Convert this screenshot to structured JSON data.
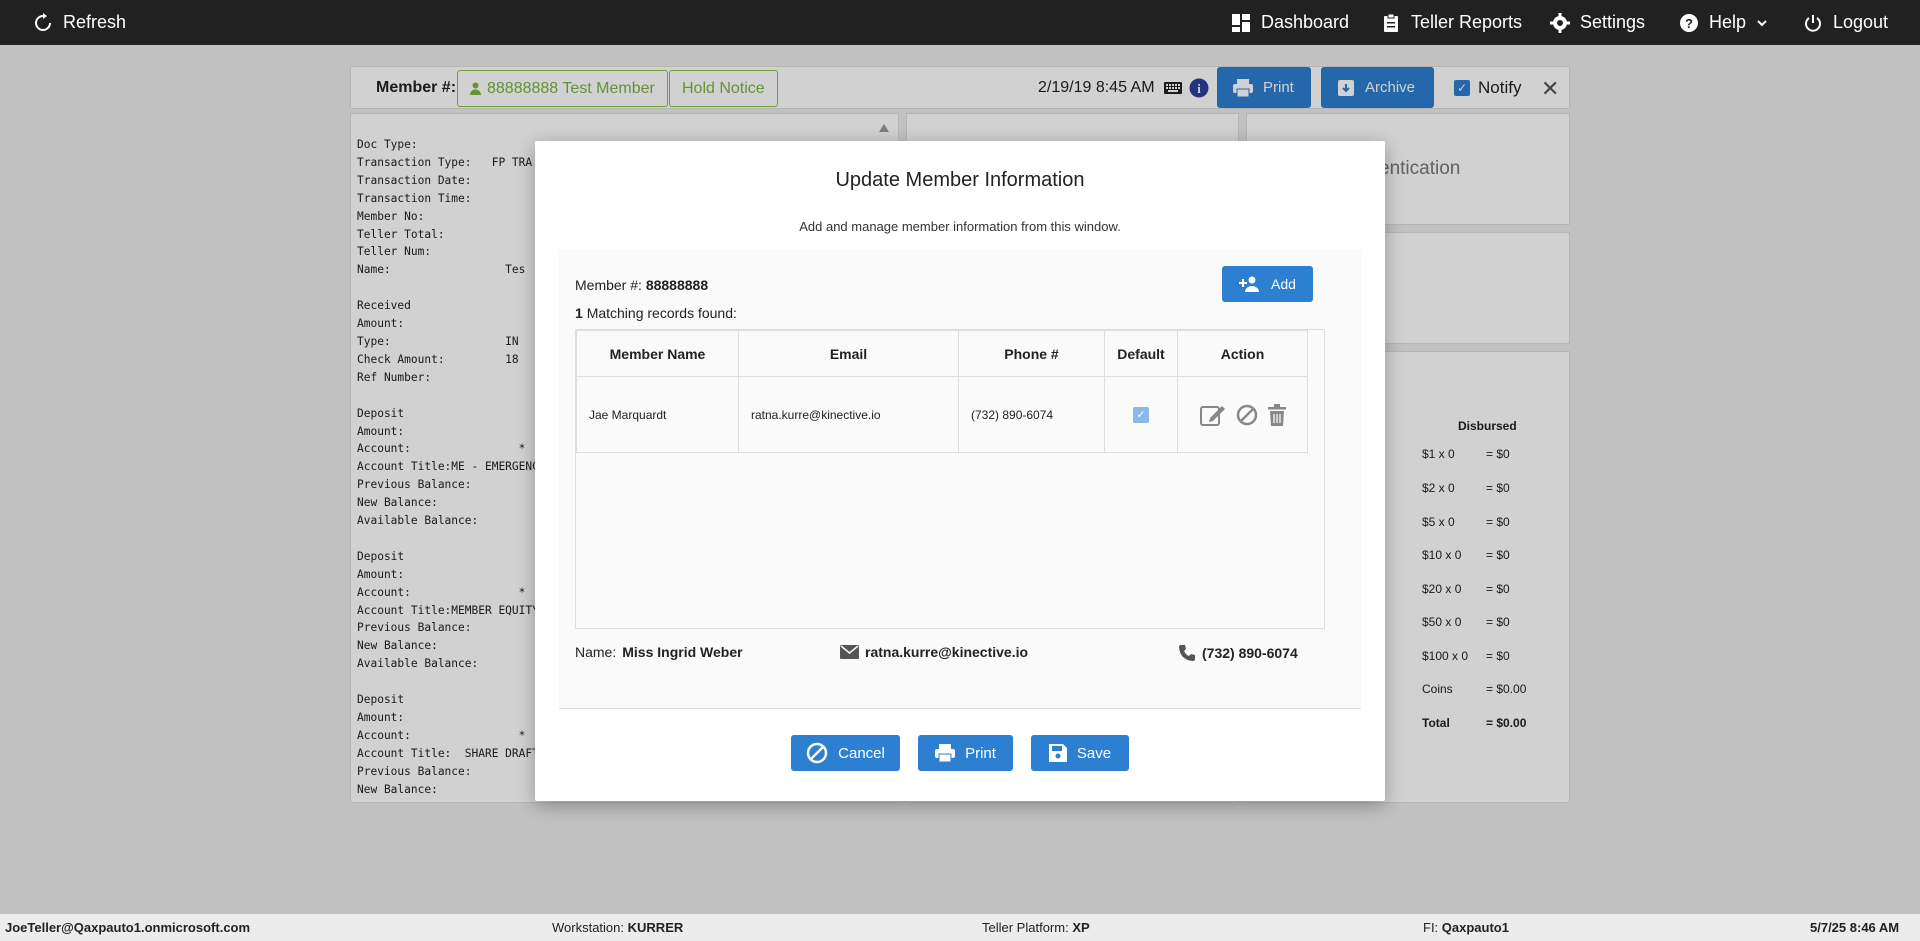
{
  "topnav": {
    "refresh": "Refresh",
    "dashboard": "Dashboard",
    "teller_reports": "Teller Reports",
    "settings": "Settings",
    "help": "Help",
    "logout": "Logout"
  },
  "memberbar": {
    "label": "Member #:",
    "member_button": "88888888 Test Member",
    "hold_notice": "Hold Notice",
    "datetime": "2/19/19 8:45 AM",
    "print": "Print",
    "archive": "Archive",
    "notify": "Notify"
  },
  "receipt": {
    "text": "Doc Type:\nTransaction Type:   FP TRA\nTransaction Date:\nTransaction Time:\nMember No:\nTeller Total:\nTeller Num:\nName:                 Tes\n\nReceived\nAmount:\nType:                 IN\nCheck Amount:         18\nRef Number:\n\nDeposit\nAmount:\nAccount:                *\nAccount Title:ME - EMERGENC\nPrevious Balance:\nNew Balance:\nAvailable Balance:\n\nDeposit\nAmount:\nAccount:                *\nAccount Title:MEMBER EQUITY\nPrevious Balance:\nNew Balance:\nAvailable Balance:\n\nDeposit\nAmount:\nAccount:                *\nAccount Title:  SHARE DRAFT\nPrevious Balance:\nNew Balance:"
  },
  "right_panel": {
    "auth_title": "entication",
    "disbursed_header": "Disbursed",
    "rows": [
      {
        "denom": "$1 x 0",
        "total": "= $0"
      },
      {
        "denom": "$2 x 0",
        "total": "= $0"
      },
      {
        "denom": "$5 x 0",
        "total": "= $0"
      },
      {
        "denom": "$10 x 0",
        "total": "= $0"
      },
      {
        "denom": "$20 x 0",
        "total": "= $0"
      },
      {
        "denom": "$50 x 0",
        "total": "= $0"
      },
      {
        "denom": "$100 x 0",
        "total": "= $0"
      },
      {
        "denom": "Coins",
        "total": "= $0.00"
      },
      {
        "denom": "Total",
        "total": "= $0.00"
      }
    ]
  },
  "modal": {
    "title": "Update Member Information",
    "subtitle": "Add and manage member information from this window.",
    "member_label": "Member #:",
    "member_number": "88888888",
    "match_count": "1",
    "match_text": "Matching records found:",
    "add_button": "Add",
    "columns": [
      "Member Name",
      "Email",
      "Phone #",
      "Default",
      "Action"
    ],
    "rows": [
      {
        "name": "Jae Marquardt",
        "email": "ratna.kurre@kinective.io",
        "phone": "(732) 890-6074",
        "default": true
      }
    ],
    "name_label": "Name:",
    "name_value": "Miss Ingrid Weber",
    "email_value": "ratna.kurre@kinective.io",
    "phone_value": "(732) 890-6074",
    "cancel": "Cancel",
    "print": "Print",
    "save": "Save"
  },
  "statusbar": {
    "user": "JoeTeller@Qaxpauto1.onmicrosoft.com",
    "workstation_label": "Workstation:",
    "workstation": "KURRER",
    "platform_label": "Teller Platform:",
    "platform": "XP",
    "fi_label": "FI:",
    "fi": "Qaxpauto1",
    "datetime": "5/7/25 8:46 AM"
  },
  "colors": {
    "primary": "#2d7fd1",
    "nav_bg": "#212121",
    "green": "#7cb342"
  }
}
